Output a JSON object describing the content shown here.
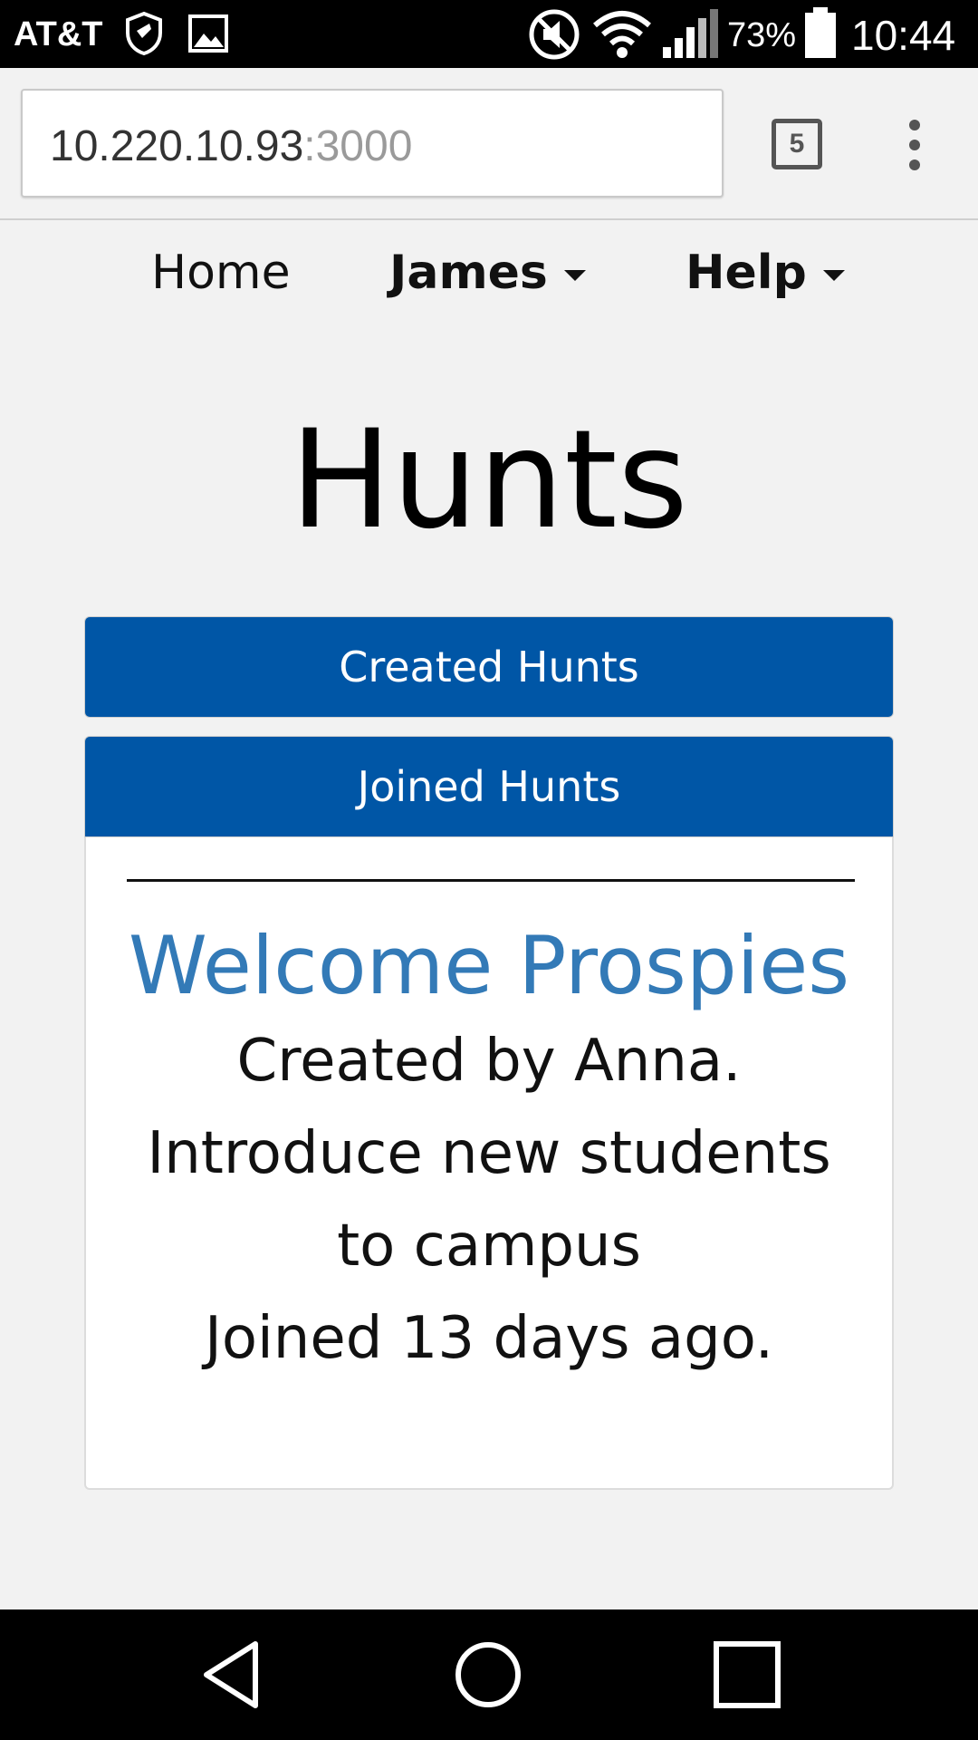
{
  "status_bar": {
    "carrier": "AT&T",
    "battery_percent": "73%",
    "time": "10:44",
    "icons": [
      "shield-icon",
      "image-icon",
      "mute-icon",
      "wifi-icon",
      "signal-icon",
      "battery-icon"
    ]
  },
  "browser": {
    "url_host": "10.220.10.93",
    "url_port": ":3000",
    "tab_count": "5"
  },
  "nav": {
    "home": "Home",
    "user": "James",
    "help": "Help"
  },
  "page": {
    "title": "Hunts",
    "created_hunts": "Created Hunts",
    "joined_hunts": "Joined Hunts"
  },
  "hunt": {
    "name": "Welcome Prospies",
    "creator": "Created by Anna.",
    "description_line1": "Introduce new students",
    "description_line2": "to campus",
    "joined": "Joined 13 days ago."
  },
  "colors": {
    "panel_header": "#0056a6",
    "link": "#337ab7"
  }
}
